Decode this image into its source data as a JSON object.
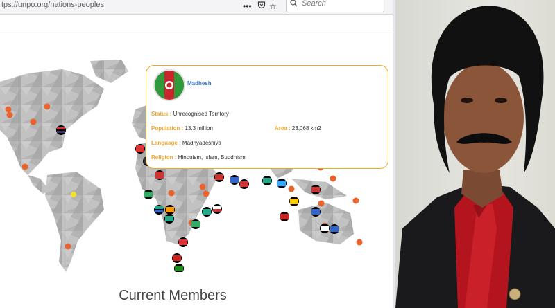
{
  "browser": {
    "url": "tps://unpo.org/nations-peoples",
    "search_placeholder": "Search",
    "icons": [
      "more-icon",
      "pocket-icon",
      "bookmark-star-icon",
      "search-icon"
    ]
  },
  "popup": {
    "name": "Madhesh",
    "status_label": "Status :",
    "status_value": "Unrecognised Territory",
    "population_label": "Population :",
    "population_value": "13.3 million",
    "area_label": "Area :",
    "area_value": "23,068 km2",
    "language_label": "Language :",
    "language_value": "Madhyadeshiya",
    "religion_label": "Religion :",
    "religion_value": "Hinduism, Islam, Buddhism"
  },
  "main": {
    "heading": "Current Members"
  },
  "colors": {
    "popup_border": "#f0a72a",
    "popup_label": "#f0a72a",
    "popup_name": "#3a7ac2",
    "marker": "#e8632d",
    "highlight_marker": "#f3e324",
    "map_land": "#b9b9b9"
  }
}
